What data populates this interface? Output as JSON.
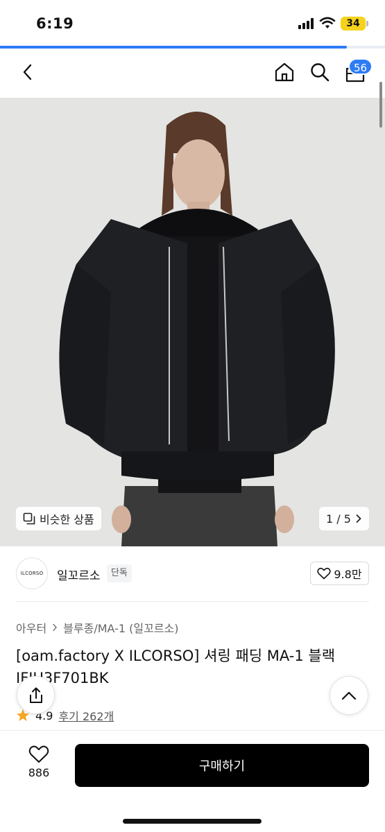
{
  "status_bar": {
    "time": "6:19",
    "battery": "34",
    "icons": [
      "cellular-signal-icon",
      "wifi-icon",
      "battery-icon"
    ]
  },
  "load_progress": 0.9,
  "navbar": {
    "back_icon": "chevron-left-icon",
    "home_icon": "home-icon",
    "search_icon": "search-icon",
    "cart_icon": "shopping-bag-icon",
    "cart_count": "56"
  },
  "gallery": {
    "similar_label": "비슷한 상품",
    "page_indicator": "1 / 5",
    "colors": {
      "background": "#e4e4e2",
      "jacket": "#1c1e22"
    }
  },
  "brand": {
    "logo_text": "ILCORSO",
    "name": "일꼬르소",
    "tag": "단독",
    "like_count": "9.8만"
  },
  "breadcrumb": {
    "level1": "아우터",
    "level2": "블루종/MA-1 (일꼬르소)"
  },
  "product": {
    "title": "[oam.factory X ILCORSO] 셔링 패딩 MA-1 블랙 IFJU3F701BK",
    "rating": "4.9",
    "reviews": "후기 262개"
  },
  "bottom_bar": {
    "wish_count": "886",
    "buy_label": "구매하기"
  },
  "colors": {
    "accent": "#2d7cf5",
    "buy_button": "#000000",
    "star": "#f5a623",
    "battery": "#f5d21e"
  }
}
